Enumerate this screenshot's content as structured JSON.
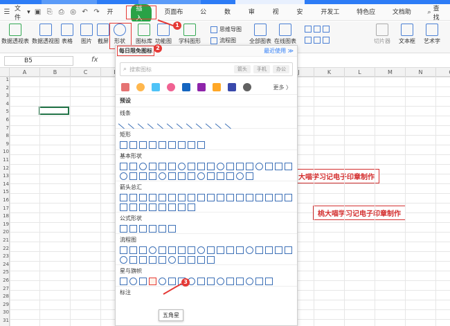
{
  "menubar": {
    "file_label": "文件",
    "tabs": [
      "开始",
      "插入",
      "页面布局",
      "公式",
      "数据",
      "审阅",
      "视图",
      "安全",
      "开发工具",
      "特色应用",
      "文档助手"
    ],
    "active_tab": "插入",
    "search_label": "查找"
  },
  "ribbon": {
    "pivot_table": "数据透视表",
    "pivot_chart": "数据透视图",
    "table": "表格",
    "picture": "图片",
    "screenshot": "截屏",
    "shape": "形状",
    "icon_lib": "图标库",
    "function_chart": "功能图",
    "subject_shape": "学科图形",
    "mind_map": "思维导图",
    "flowchart": "流程图",
    "all_charts": "全部图表",
    "online_charts": "在线图表",
    "slicer": "切片器",
    "textbox": "文本框",
    "art_text": "艺术字"
  },
  "formula_bar": {
    "name_box": "B5",
    "fx": "fx"
  },
  "columns": [
    "A",
    "B",
    "C",
    "D",
    "E",
    "F",
    "G",
    "H",
    "I",
    "J",
    "K",
    "L",
    "M",
    "N",
    "O"
  ],
  "rows": [
    "1",
    "2",
    "3",
    "4",
    "5",
    "6",
    "7",
    "8",
    "9",
    "10",
    "11",
    "12",
    "13",
    "14",
    "15",
    "16",
    "17",
    "18",
    "19",
    "20",
    "21",
    "22",
    "23",
    "24",
    "25",
    "26",
    "27",
    "28",
    "29",
    "30",
    "31"
  ],
  "stamps": [
    "大喵学习记电子印章制作",
    "桃大喵学习记电子印章制作"
  ],
  "panel": {
    "header_title": "每日限免图标",
    "header_recent": "最近使用 ≫",
    "search_placeholder": "搜索图标",
    "search_tags": [
      "箭头",
      "手机",
      "办公"
    ],
    "more_label": "更多 〉",
    "preset_label": "预设",
    "sections": [
      "线条",
      "矩形",
      "基本形状",
      "箭头总汇",
      "公式形状",
      "流程图",
      "星与旗帜",
      "标注"
    ],
    "tooltip": "五角星"
  },
  "badges": [
    "1",
    "2",
    "3"
  ]
}
